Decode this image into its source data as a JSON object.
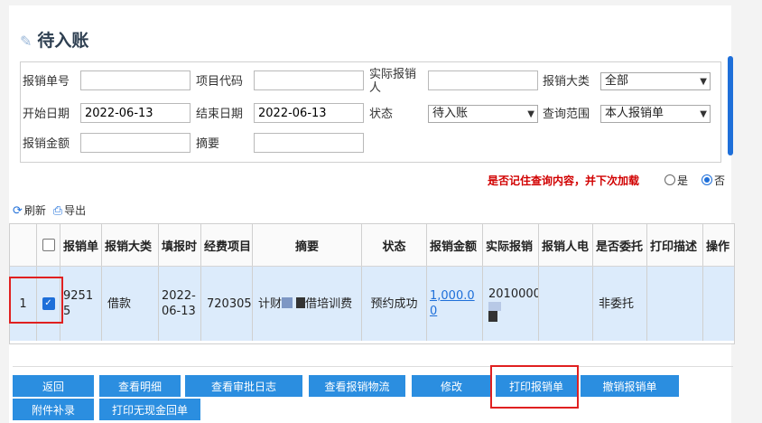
{
  "page": {
    "title": "待入账"
  },
  "filters": {
    "bill_no_label": "报销单号",
    "bill_no_value": "",
    "project_code_label": "项目代码",
    "project_code_value": "",
    "actual_reimburser_label": "实际报销人",
    "actual_reimburser_value": "",
    "category_label": "报销大类",
    "category_value": "全部",
    "start_date_label": "开始日期",
    "start_date_value": "2022-06-13",
    "end_date_label": "结束日期",
    "end_date_value": "2022-06-13",
    "status_label": "状态",
    "status_value": "待入账",
    "scope_label": "查询范围",
    "scope_value": "本人报销单",
    "amount_label": "报销金额",
    "amount_value": "",
    "summary_label": "摘要",
    "summary_value": ""
  },
  "remember": {
    "text": "是否记住查询内容，并下次加载",
    "yes": "是",
    "no": "否",
    "selected": "否"
  },
  "toolbar": {
    "refresh": "刷新",
    "export": "导出",
    "refresh_icon": "refresh-icon",
    "export_icon": "printer-icon"
  },
  "table": {
    "headers": [
      "报销单",
      "报销大类",
      "填报时",
      "经费项目",
      "摘要",
      "状态",
      "报销金额",
      "实际报销",
      "报销人电",
      "是否委托",
      "打印描述",
      "操作"
    ],
    "rows": [
      {
        "index": "1",
        "checked": true,
        "bill_no": "92515",
        "category": "借款",
        "date": "2022-06-13",
        "project": "720305",
        "summary_a": "计财",
        "summary_b": "借培训费",
        "status": "预约成功",
        "amount": "1,000.00",
        "actual": "2010000",
        "phone": "",
        "entrusted": "非委托",
        "print_desc": "",
        "ops": ""
      }
    ]
  },
  "buttons": {
    "back": "返回",
    "detail": "查看明细",
    "audit_log": "查看审批日志",
    "logistics": "查看报销物流",
    "modify": "修改",
    "print": "打印报销单",
    "cancel": "撤销报销单",
    "attach": "附件补录",
    "print_no_cash": "打印无现金回单"
  }
}
